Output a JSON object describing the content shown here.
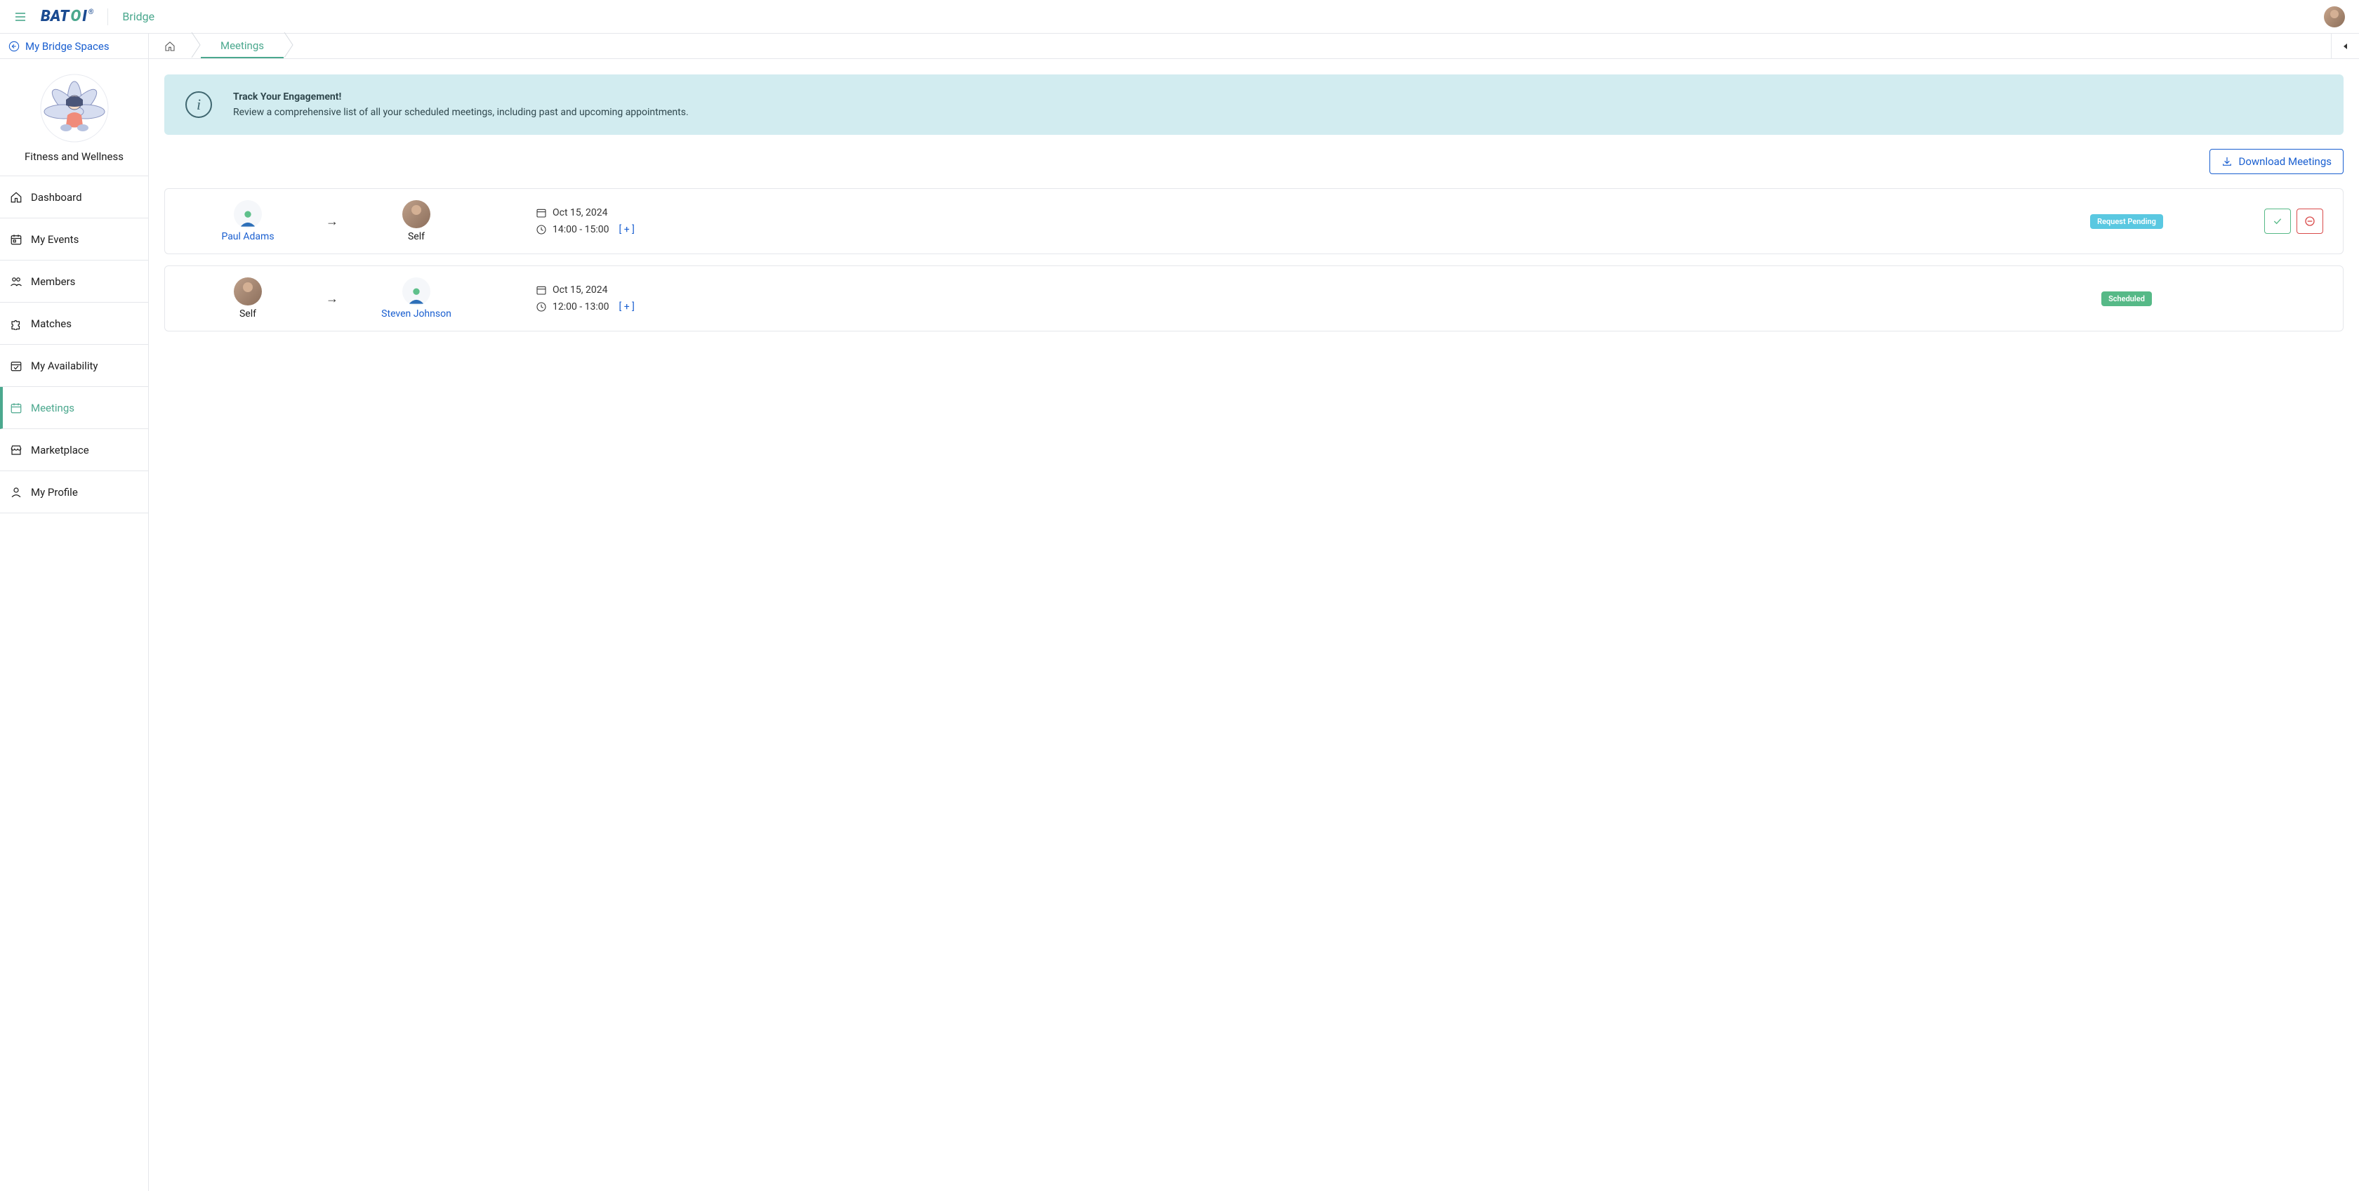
{
  "header": {
    "logo_text": "BATOI",
    "app_name": "Bridge"
  },
  "sidebar": {
    "back_label": "My Bridge Spaces",
    "space_name": "Fitness and Wellness",
    "items": [
      {
        "label": "Dashboard",
        "icon": "home"
      },
      {
        "label": "My Events",
        "icon": "calendar-event"
      },
      {
        "label": "Members",
        "icon": "users"
      },
      {
        "label": "Matches",
        "icon": "puzzle"
      },
      {
        "label": "My Availability",
        "icon": "calendar-check"
      },
      {
        "label": "Meetings",
        "icon": "calendar"
      },
      {
        "label": "Marketplace",
        "icon": "store"
      },
      {
        "label": "My Profile",
        "icon": "user"
      }
    ]
  },
  "breadcrumb": {
    "current": "Meetings"
  },
  "banner": {
    "title": "Track Your Engagement!",
    "desc": "Review a comprehensive list of all your scheduled meetings, including past and upcoming appointments."
  },
  "download_label": "Download Meetings",
  "expand_label": "[ + ]",
  "meetings": [
    {
      "from_name": "Paul Adams",
      "from_link": true,
      "from_avatar": "generic",
      "to_name": "Self",
      "to_link": false,
      "to_avatar": "photo",
      "date": "Oct 15, 2024",
      "time": "14:00 - 15:00",
      "status": "Request Pending",
      "status_class": "pending",
      "actions": true
    },
    {
      "from_name": "Self",
      "from_link": false,
      "from_avatar": "photo",
      "to_name": "Steven Johnson",
      "to_link": true,
      "to_avatar": "generic",
      "date": "Oct 15, 2024",
      "time": "12:00 - 13:00",
      "status": "Scheduled",
      "status_class": "scheduled",
      "actions": false
    }
  ]
}
